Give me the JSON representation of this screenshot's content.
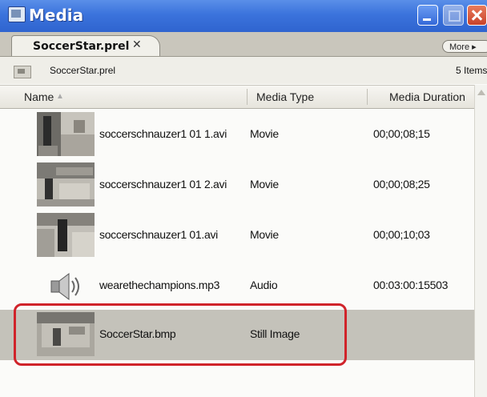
{
  "window": {
    "title": "Media",
    "icon": "panel-icon",
    "controls": [
      "minimize-icon",
      "maximize-icon",
      "close-icon"
    ]
  },
  "tab": {
    "label": "SoccerStar.prel",
    "close_glyph": "✕"
  },
  "more_button": {
    "label": "More ▸"
  },
  "pathbar": {
    "path": "SoccerStar.prel",
    "item_count": "5 Items"
  },
  "columns": {
    "name": "Name",
    "sort_glyph": "▲",
    "type": "Media Type",
    "duration": "Media Duration"
  },
  "rows": [
    {
      "name": "soccerschnauzer1 01 1.avi",
      "type": "Movie",
      "duration": "00;00;08;15",
      "thumb": "video-thumbnail"
    },
    {
      "name": "soccerschnauzer1 01 2.avi",
      "type": "Movie",
      "duration": "00;00;08;25",
      "thumb": "video-thumbnail"
    },
    {
      "name": "soccerschnauzer1 01.avi",
      "type": "Movie",
      "duration": "00;00;10;03",
      "thumb": "video-thumbnail"
    },
    {
      "name": "wearethechampions.mp3",
      "type": "Audio",
      "duration": "00:03:00:15503",
      "thumb": "speaker-icon"
    },
    {
      "name": "SoccerStar.bmp",
      "type": "Still Image",
      "duration": "",
      "thumb": "image-thumbnail",
      "selected": true
    }
  ],
  "colors": {
    "titlebar": "#3b73dc",
    "selection": "#c4c2ba",
    "highlight_ring": "#d0232a"
  }
}
